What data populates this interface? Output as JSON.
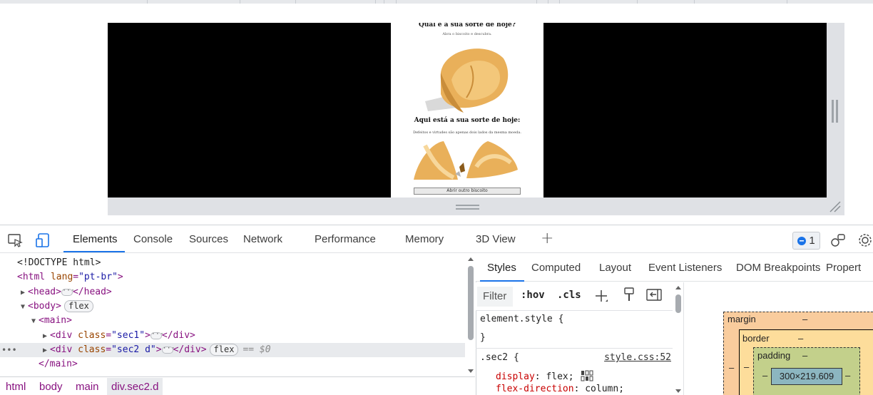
{
  "viewport": {
    "page": {
      "title": "Qual é a sua sorte de hoje?",
      "subtitle": "Abra o biscoito e descubra.",
      "result_title": "Aqui está a sua sorte de hoje:",
      "fortune_text": "Defeitos e virtudes são apenas dois lados da mesma moeda.",
      "button_label": "Abrir outro biscoito"
    }
  },
  "devtools": {
    "toolbar": {
      "tabs": [
        "Elements",
        "Console",
        "Sources",
        "Network",
        "Performance",
        "Memory",
        "3D View"
      ],
      "active_tab": "Elements",
      "issues_count": "1"
    },
    "dom": {
      "lines": {
        "doctype": "<!DOCTYPE html>",
        "html_open": "<html",
        "html_attr_name": "lang",
        "html_attr_val": "\"pt-br\"",
        "html_close": ">",
        "head_open": "<head>",
        "head_close": "</head>",
        "body_open": "<body>",
        "body_badge": "flex",
        "main_open": "<main>",
        "div1_open": "<div",
        "div1_attr_name": "class",
        "div1_attr_val": "\"sec1\"",
        "div1_close": "</div>",
        "div2_open": "<div",
        "div2_attr_name": "class",
        "div2_attr_val": "\"sec2 d\"",
        "div2_close": "</div>",
        "div2_badge": "flex",
        "div2_selected_marker": "== $0",
        "main_close": "</main>"
      },
      "breadcrumb": [
        "html",
        "body",
        "main",
        "div.sec2.d"
      ]
    },
    "styles": {
      "sub_tabs": [
        "Styles",
        "Computed",
        "Layout",
        "Event Listeners",
        "DOM Breakpoints",
        "Propert"
      ],
      "active_sub_tab": "Styles",
      "filter_placeholder": "Filter",
      "hov_label": ":hov",
      "cls_label": ".cls",
      "element_style_selector": "element.style {",
      "element_style_close": "}",
      "rule_selector": ".sec2 {",
      "rule_source": "style.css:52",
      "declarations": [
        {
          "prop": "display",
          "value": "flex;"
        },
        {
          "prop": "flex-direction",
          "value": "column;"
        }
      ]
    },
    "box_model": {
      "margin_label": "margin",
      "border_label": "border",
      "padding_label": "padding",
      "dash": "–",
      "content_size": "300×219.609"
    }
  },
  "colors": {
    "accent": "#1a73e8",
    "tag": "#881280",
    "attr_name": "#994500",
    "attr_value": "#1a1aa6",
    "css_prop": "#c80000"
  }
}
